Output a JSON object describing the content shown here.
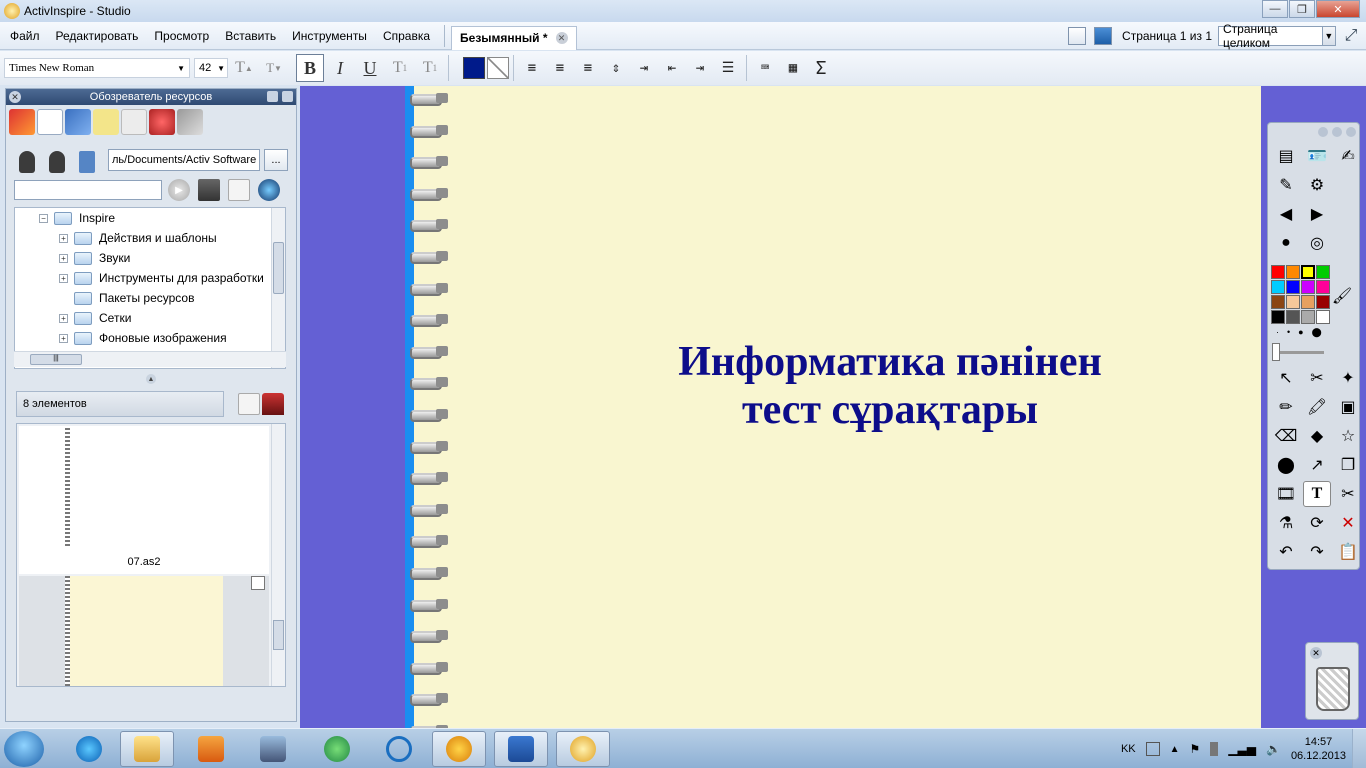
{
  "window": {
    "title": "ActivInspire - Studio",
    "buttons": [
      "—",
      "❐",
      "✕"
    ]
  },
  "menu": {
    "items": [
      "Файл",
      "Редактировать",
      "Просмотр",
      "Вставить",
      "Инструменты",
      "Справка"
    ],
    "tab_label": "Безымянный *",
    "page_info": "Страница 1 из 1",
    "zoom": "Страница целиком"
  },
  "format": {
    "font": "Times New Roman",
    "size": "42",
    "bold": "B",
    "italic": "I",
    "underline": "U"
  },
  "browser": {
    "title": "Обозреватель ресурсов",
    "path": "ль/Documents/Activ Software",
    "browse": "...",
    "tree": [
      {
        "label": "Inspire",
        "level": 0,
        "expander": "−"
      },
      {
        "label": "Действия и шаблоны",
        "level": 1,
        "expander": "+"
      },
      {
        "label": "Звуки",
        "level": 1,
        "expander": "+"
      },
      {
        "label": "Инструменты для разработки",
        "level": 1,
        "expander": "+"
      },
      {
        "label": "Пакеты ресурсов",
        "level": 1,
        "expander": ""
      },
      {
        "label": "Сетки",
        "level": 1,
        "expander": "+"
      },
      {
        "label": "Фоновые изображения",
        "level": 1,
        "expander": "+"
      }
    ],
    "count": "8 элементов",
    "thumb_label": "07.as2"
  },
  "slide": {
    "line1": "Информатика пәнінен",
    "line2": "тест сұрақтары",
    "colors": {
      "page": "#f9f6d0",
      "background": "#6460d4",
      "title": "#0d0d8a"
    }
  },
  "toolbox": {
    "palette": [
      "#ff0000",
      "#ff8800",
      "#ffff00",
      "#00cc00",
      "#00ccff",
      "#0000ff",
      "#cc00ff",
      "#ff0099",
      "#8b4513",
      "#f5c89a",
      "#e6a060",
      "#990000",
      "#000000",
      "#555555",
      "#aaaaaa",
      "#ffffff"
    ]
  },
  "taskbar": {
    "lang": "KK",
    "time": "14:57",
    "date": "06.12.2013"
  }
}
